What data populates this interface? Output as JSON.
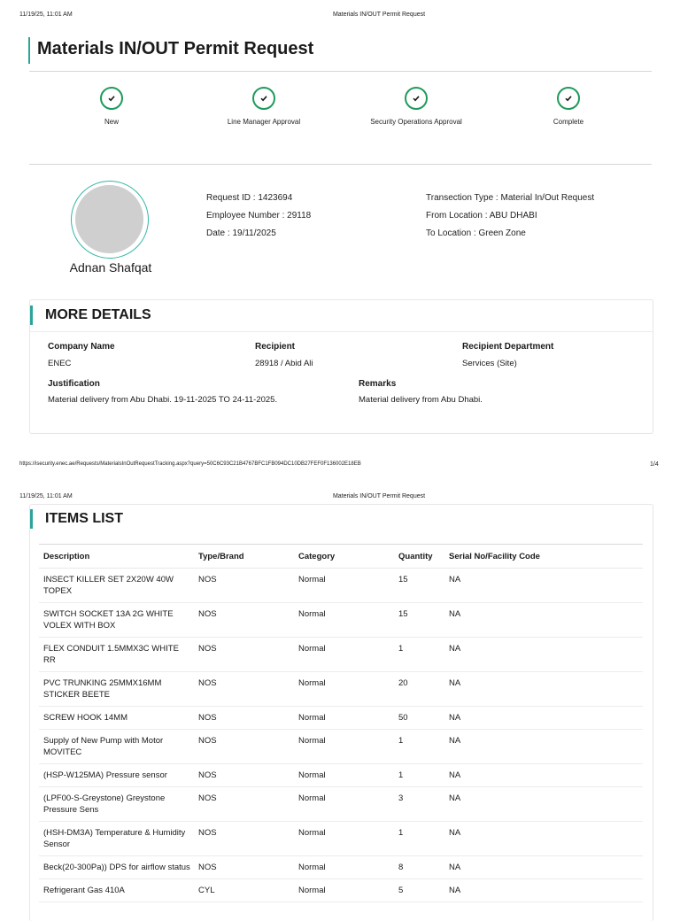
{
  "print_header": {
    "timestamp": "11/19/25, 11:01 AM",
    "doc_title": "Materials IN/OUT Permit Request"
  },
  "page_title": "Materials IN/OUT Permit Request",
  "steps": [
    {
      "label": "New",
      "icon": "check-icon",
      "status": "done"
    },
    {
      "label": "Line Manager Approval",
      "icon": "check-icon",
      "status": "done"
    },
    {
      "label": "Security Operations Approval",
      "icon": "check-icon",
      "status": "done"
    },
    {
      "label": "Complete",
      "icon": "check-icon",
      "status": "done"
    }
  ],
  "employee": {
    "name": "Adnan Shafqat",
    "request_id": "Request ID : 1423694",
    "employee_number": "Employee Number : 29118",
    "date": "Date : 19/11/2025",
    "transaction_type": "Transection Type : Material In/Out Request",
    "from_location": "From Location : ABU DHABI",
    "to_location": "To Location : Green Zone"
  },
  "more_details": {
    "title": "MORE DETAILS",
    "company_name_label": "Company Name",
    "company_name": "ENEC",
    "recipient_label": "Recipient",
    "recipient": "28918 / Abid Ali",
    "recipient_department_label": "Recipient Department",
    "recipient_department": "Services (Site)",
    "justification_label": "Justification",
    "justification": "Material delivery from Abu Dhabi. 19-11-2025 TO 24-11-2025.",
    "remarks_label": "Remarks",
    "remarks": "Material delivery from Abu Dhabi."
  },
  "print_footer": {
    "url": "https://isecurity.enec.ae/Requests/MaterialsInOutRequestTracking.aspx?query=50C6C93C21B4767BFC1FB094DC10DB27FEF0F136002E18EB",
    "page": "1/4"
  },
  "items_list": {
    "title": "ITEMS LIST",
    "columns": [
      "Description",
      "Type/Brand",
      "Category",
      "Quantity",
      "Serial No/Facility Code"
    ],
    "rows": [
      [
        "INSECT KILLER SET 2X20W 40W TOPEX",
        "NOS",
        "Normal",
        "15",
        "NA"
      ],
      [
        "SWITCH SOCKET 13A 2G WHITE VOLEX WITH BOX",
        "NOS",
        "Normal",
        "15",
        "NA"
      ],
      [
        "FLEX CONDUIT 1.5MMX3C WHITE RR",
        "NOS",
        "Normal",
        "1",
        "NA"
      ],
      [
        "PVC TRUNKING 25MMX16MM STICKER BEETE",
        "NOS",
        "Normal",
        "20",
        "NA"
      ],
      [
        "SCREW HOOK 14MM",
        "NOS",
        "Normal",
        "50",
        "NA"
      ],
      [
        "Supply of New Pump with Motor MOVITEC",
        "NOS",
        "Normal",
        "1",
        "NA"
      ],
      [
        "(HSP-W125MA) Pressure sensor",
        "NOS",
        "Normal",
        "1",
        "NA"
      ],
      [
        "(LPF00-S-Greystone) Greystone Pressure Sens",
        "NOS",
        "Normal",
        "3",
        "NA"
      ],
      [
        "(HSH-DM3A) Temperature & Humidity Sensor",
        "NOS",
        "Normal",
        "1",
        "NA"
      ],
      [
        "Beck(20-300Pa)) DPS for airflow status",
        "NOS",
        "Normal",
        "8",
        "NA"
      ],
      [
        "Refrigerant Gas 410A",
        "CYL",
        "Normal",
        "5",
        "NA"
      ]
    ]
  },
  "colors": {
    "accent": "#2aa59a",
    "step_green": "#1f9a5c",
    "avatar_placeholder": "#cfcfcf"
  }
}
